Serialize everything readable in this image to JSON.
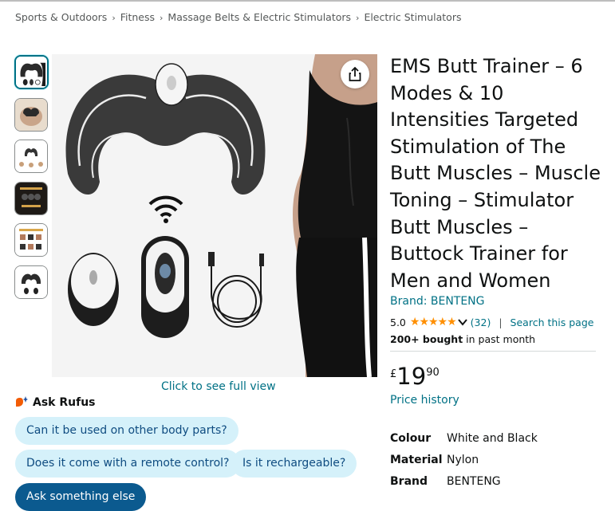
{
  "breadcrumb": [
    "Sports & Outdoors",
    "Fitness",
    "Massage Belts & Electric Stimulators",
    "Electric Stimulators"
  ],
  "breadcrumb_separator": "›",
  "thumbnails_count": 6,
  "gallery": {
    "full_view_label": "Click to see full view"
  },
  "product": {
    "title": "EMS Butt Trainer – 6 Modes & 10 Intensities Targeted Stimulation of The Butt Muscles – Muscle Toning – Stimulator Butt Muscles – Buttock Trainer for Men and Women",
    "brand": "Brand: BENTENG",
    "rating": "5.0",
    "stars_glyph": "★★★★★",
    "rating_count": "(32)",
    "search_page": "Search this page",
    "bought_bold": "200+ bought",
    "bought_rest": " in past month",
    "price": {
      "currency": "£",
      "whole": "19",
      "fraction": "90"
    },
    "price_history": "Price history",
    "specs": [
      {
        "key": "Colour",
        "value": "White and Black"
      },
      {
        "key": "Material",
        "value": "Nylon"
      },
      {
        "key": "Brand",
        "value": "BENTENG"
      }
    ]
  },
  "rufus": {
    "title": "Ask Rufus",
    "chips": [
      "Can it be used on other body parts?",
      "Does it come with a remote control?",
      "Is it rechargeable?"
    ],
    "ask_label": "Ask something else"
  },
  "colors": {
    "link": "#007185",
    "chip_bg": "#d5f1fa",
    "star": "#ff8f00",
    "rufus_orange": "#f25c05",
    "selected_border": "#007185"
  },
  "icons": [
    "share-icon",
    "chevron-down-icon",
    "rufus-icon",
    "wifi-icon"
  ]
}
